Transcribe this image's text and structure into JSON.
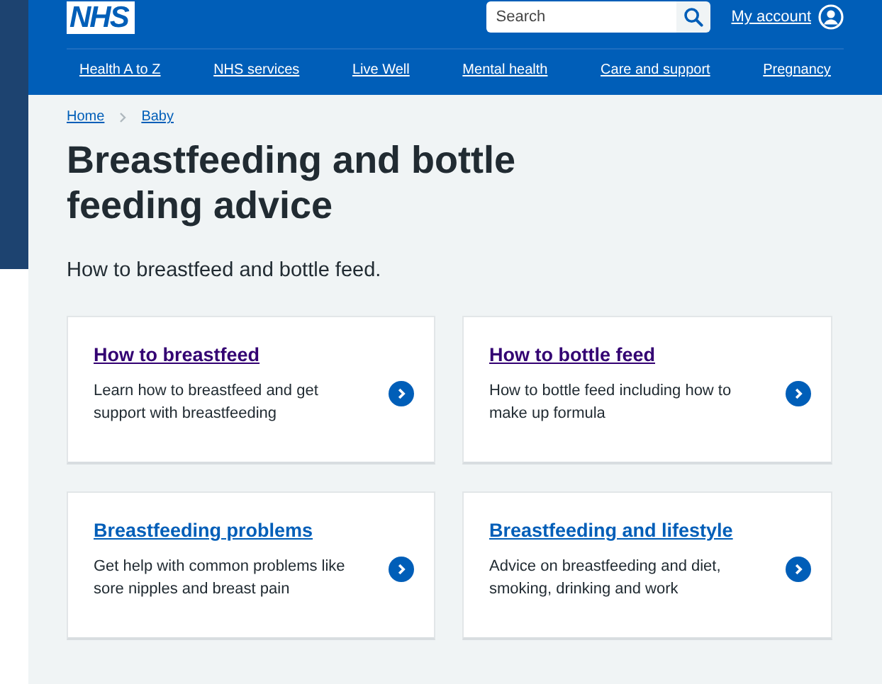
{
  "header": {
    "logo": "NHS",
    "search": {
      "placeholder": "Search"
    },
    "account": "My account",
    "nav": [
      "Health A to Z",
      "NHS services",
      "Live Well",
      "Mental health",
      "Care and support",
      "Pregnancy"
    ]
  },
  "breadcrumbs": [
    "Home",
    "Baby"
  ],
  "title": "Breastfeeding and bottle feeding advice",
  "lead": "How to breastfeed and bottle feed.",
  "cards": [
    {
      "title": "How to breastfeed",
      "text": "Learn how to breastfeed and get support with breastfeeding",
      "visited": true
    },
    {
      "title": "How to bottle feed",
      "text": "How to bottle feed including how to make up formula",
      "visited": true
    },
    {
      "title": "Breastfeeding problems",
      "text": "Get help with common problems like sore nipples and breast pain",
      "visited": false
    },
    {
      "title": "Breastfeeding and lifestyle",
      "text": "Advice on breastfeeding and diet, smoking, drinking and work",
      "visited": false
    }
  ]
}
